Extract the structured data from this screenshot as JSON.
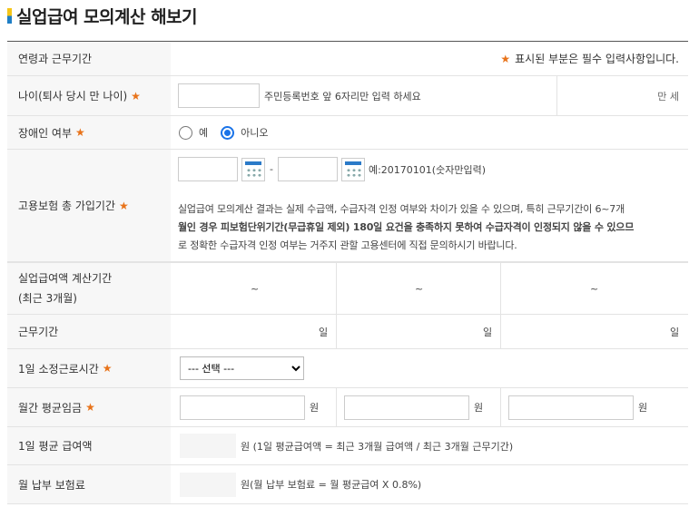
{
  "page": {
    "title": "실업급여 모의계산 해보기"
  },
  "header_row": {
    "label": "연령과 근무기간",
    "required_mark": "★",
    "required_note": "표시된 부분은 필수 입력사항입니다."
  },
  "age": {
    "label": "나이(퇴사 당시 만 나이)",
    "required_mark": "★",
    "hint": "주민등록번호 앞 6자리만 입력 하세요",
    "unit": "만 세",
    "value": ""
  },
  "disability": {
    "label": "장애인 여부",
    "required_mark": "★",
    "option_yes": "예",
    "option_no": "아니오",
    "selected": "아니오"
  },
  "insurance_period": {
    "label": "고용보험 총 가입기간",
    "required_mark": "★",
    "separator": "-",
    "date_hint": "예:20170101(숫자만입력)",
    "notice_line1": "실업급여 모의계산 결과는 실제 수급액, 수급자격 인정 여부와 차이가 있을 수 있으며, 특히 근무기간이 6~7개",
    "notice_line2": "월인 경우 피보험단위기간(무급휴일 제외) 180일 요건을 충족하지 못하여 수급자격이 인정되지 않을 수 있으므",
    "notice_line3": "로 정확한 수급자격 인정 여부는 거주지 관할 고용센터에 직접 문의하시기 바랍니다."
  },
  "calc_period": {
    "label_line1": "실업급여액 계산기간",
    "label_line2": "(최근 3개월)",
    "separators": [
      "~",
      "~",
      "~"
    ]
  },
  "work_days": {
    "label": "근무기간",
    "units": [
      "일",
      "일",
      "일"
    ]
  },
  "daily_hours": {
    "label": "1일 소정근로시간",
    "required_mark": "★",
    "selected": "--- 선택 ---"
  },
  "monthly_wage": {
    "label": "월간 평균임금",
    "required_mark": "★",
    "units": [
      "원",
      "원",
      "원"
    ]
  },
  "daily_benefit": {
    "label": "1일 평균 급여액",
    "formula": "원 (1일 평균급여액 = 최근 3개월 급여액 / 최근 3개월 근무기간)"
  },
  "monthly_premium": {
    "label": "월 납부 보험료",
    "formula": "원(월 납부 보험료 = 월 평균급여 X 0.8%)"
  },
  "colors": {
    "accent": "#1a73e8",
    "required": "#e8731a",
    "label_bg": "#f7f7f7"
  }
}
